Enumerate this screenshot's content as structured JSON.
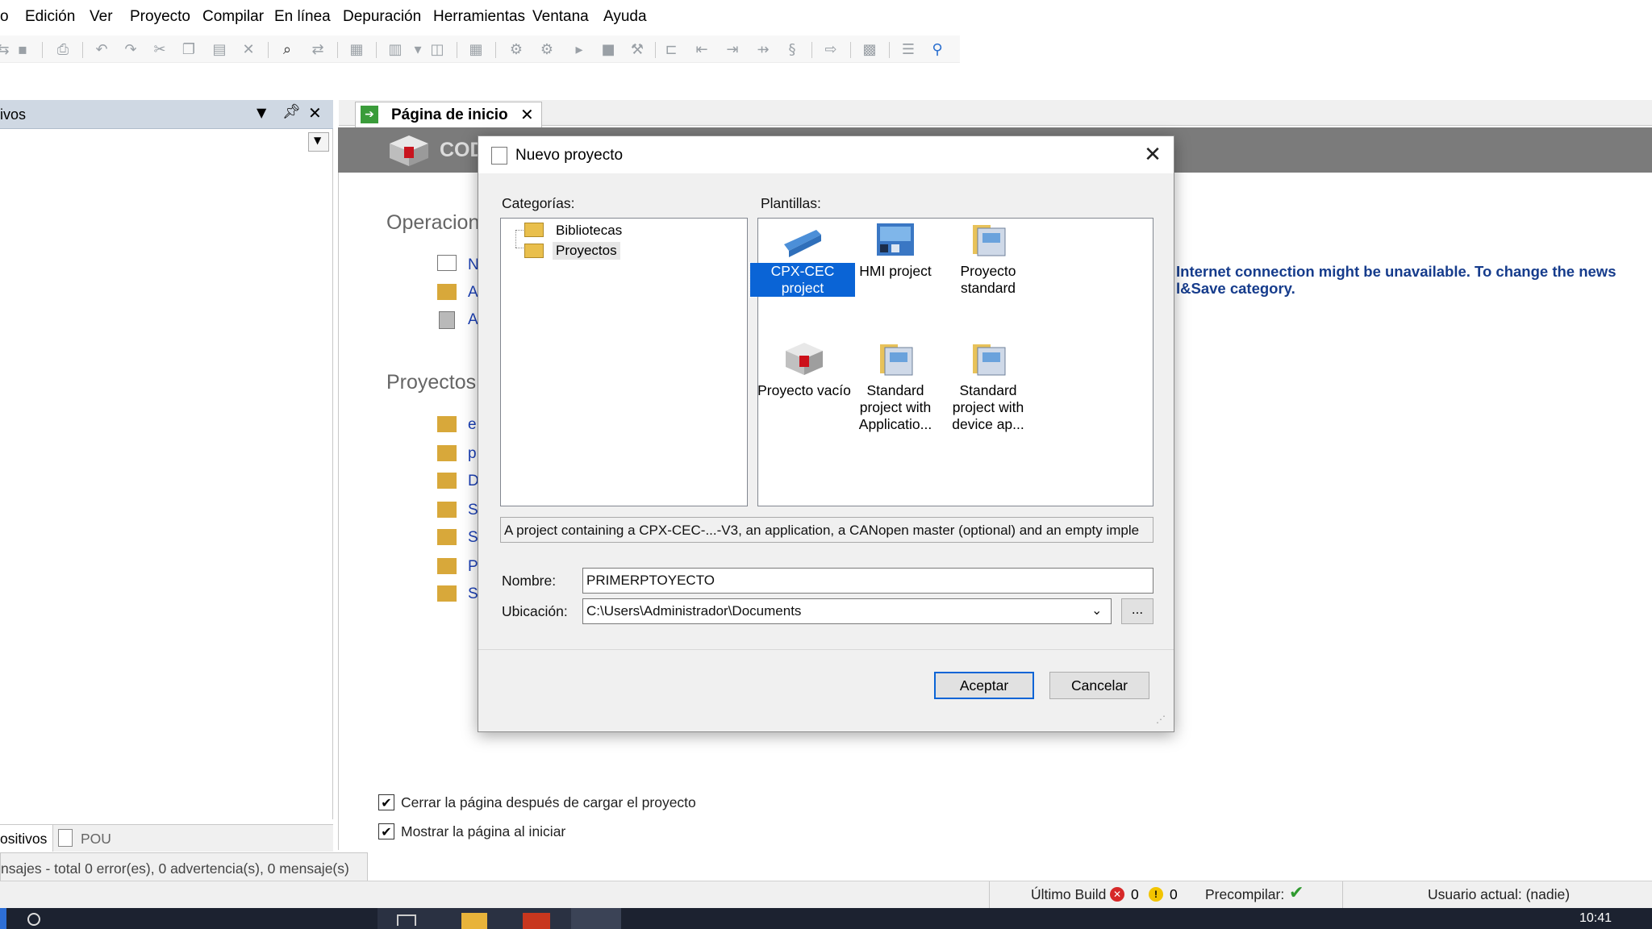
{
  "menu": {
    "items": [
      "o",
      "Edición",
      "Ver",
      "Proyecto",
      "Compilar",
      "En línea",
      "Depuración",
      "Herramientas",
      "Ventana",
      "Ayuda"
    ]
  },
  "left_panel": {
    "title": "ivos",
    "tab_devices": "ositivos",
    "tab_pou": "POU"
  },
  "doc_tab": {
    "label": "Página de inicio"
  },
  "banner": {
    "text": "COD"
  },
  "start_page": {
    "operations_heading": "Operacion",
    "operations": [
      "N",
      "A",
      "A"
    ],
    "projects_heading": "Proyectos",
    "recent": [
      "e",
      "p",
      "D",
      "S",
      "S",
      "P",
      "S"
    ],
    "news": "Internet connection might be unavailable. To change the news\nl&Save category.",
    "close_after_load": "Cerrar la página después de cargar el proyecto",
    "show_on_start": "Mostrar la página al iniciar"
  },
  "messages": {
    "text": "nsajes - total 0 error(es), 0 advertencia(s), 0 mensaje(s)"
  },
  "status": {
    "last_build_label": "Último Build",
    "errors": "0",
    "warnings": "0",
    "precompile_label": "Precompilar:",
    "user": "Usuario actual: (nadie)"
  },
  "taskbar": {
    "clock": "10:41"
  },
  "dialog": {
    "title": "Nuevo proyecto",
    "categories_label": "Categorías:",
    "templates_label": "Plantillas:",
    "categories": [
      "Bibliotecas",
      "Proyectos"
    ],
    "templates": [
      {
        "label": "CPX-CEC project",
        "icon": "cpx-device-icon",
        "selected": true
      },
      {
        "label": "HMI project",
        "icon": "hmi-screen-icon",
        "selected": false
      },
      {
        "label": "Proyecto standard",
        "icon": "standard-project-icon",
        "selected": false
      },
      {
        "label": "Proyecto vacío",
        "icon": "empty-project-cube-icon",
        "selected": false
      },
      {
        "label": "Standard project with Applicatio...",
        "icon": "standard-project-icon",
        "selected": false
      },
      {
        "label": "Standard project with device ap...",
        "icon": "standard-project-icon",
        "selected": false
      }
    ],
    "description": "A project containing a CPX-CEC-...-V3, an application, a CANopen master (optional) and an empty imple",
    "name_label": "Nombre:",
    "name_value": "PRIMERPTOYECTO",
    "location_label": "Ubicación:",
    "location_value": "C:\\Users\\Administrador\\Documents",
    "browse_label": "...",
    "ok_label": "Aceptar",
    "cancel_label": "Cancelar"
  }
}
